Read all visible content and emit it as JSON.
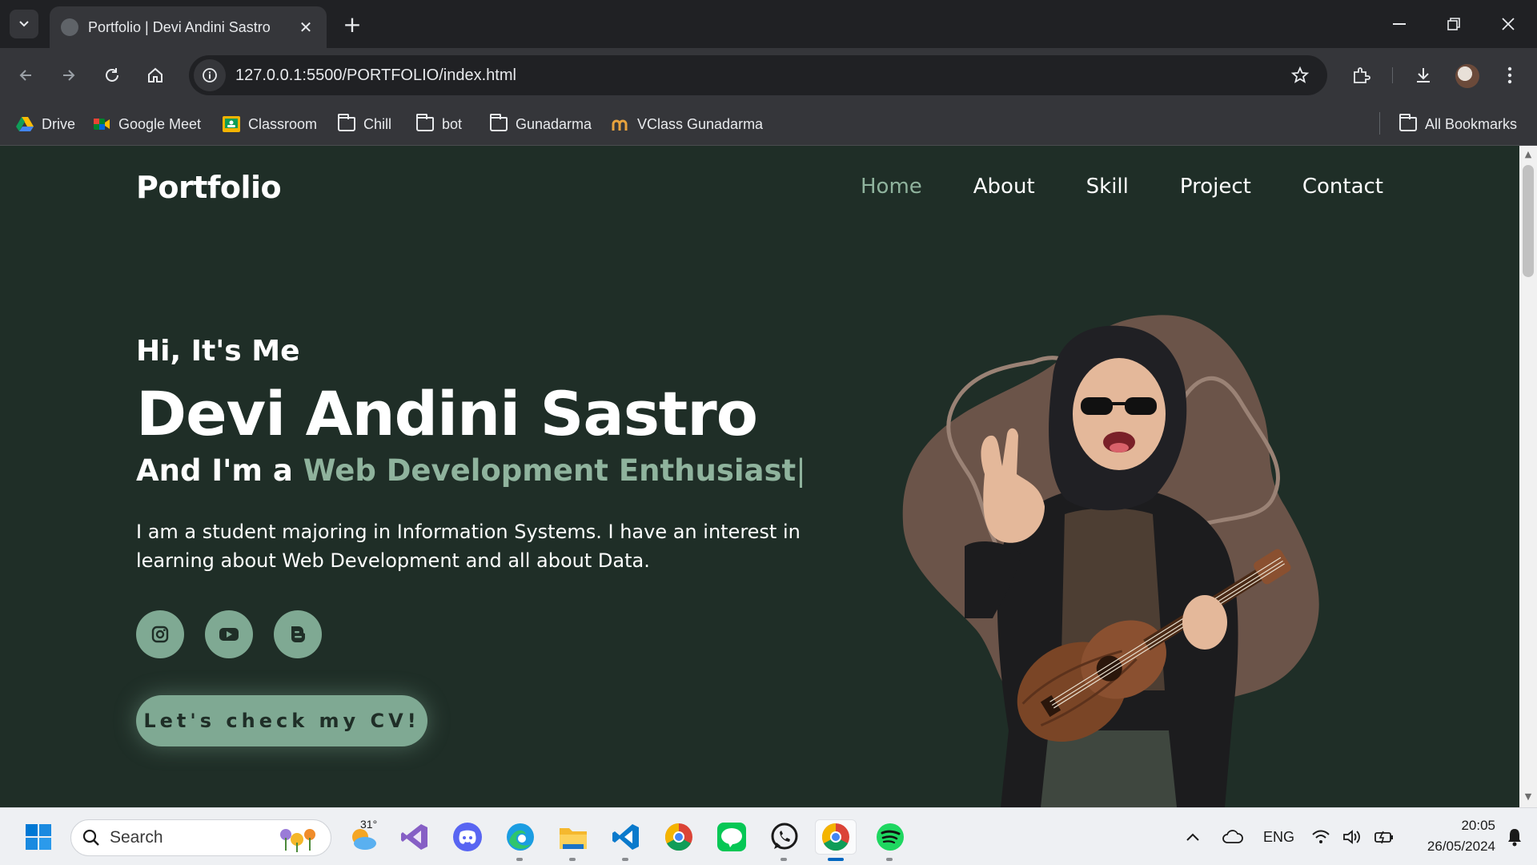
{
  "browser": {
    "tab_title": "Portfolio | Devi Andini Sastro",
    "url": "127.0.0.1:5500/PORTFOLIO/index.html",
    "bookmarks": [
      {
        "label": "Drive",
        "icon": "google-drive-icon"
      },
      {
        "label": "Google Meet",
        "icon": "google-meet-icon"
      },
      {
        "label": "Classroom",
        "icon": "google-classroom-icon"
      },
      {
        "label": "Chill",
        "icon": "folder-icon"
      },
      {
        "label": "bot",
        "icon": "folder-icon"
      },
      {
        "label": "Gunadarma",
        "icon": "folder-icon"
      },
      {
        "label": "VClass Gunadarma",
        "icon": "vclass-icon"
      }
    ],
    "all_bookmarks": "All Bookmarks"
  },
  "site": {
    "logo": "Portfolio",
    "nav": [
      "Home",
      "About",
      "Skill",
      "Project",
      "Contact"
    ],
    "active_nav": "Home",
    "greeting": "Hi, It's Me",
    "name": "Devi Andini Sastro",
    "role_prefix": "And I'm a ",
    "role_highlight": "Web Development Enthusiast",
    "role_caret": "|",
    "description": "I am a student majoring in Information Systems. I have an interest in learning about Web Development and all about Data.",
    "socials": [
      "instagram-icon",
      "youtube-icon",
      "blogger-icon"
    ],
    "cv_button": "Let's check my CV!",
    "colors": {
      "background": "#1f2e27",
      "accent": "#8fb39d",
      "button": "#7fa993",
      "blob": "#6b5449"
    }
  },
  "taskbar": {
    "search_placeholder": "Search",
    "weather_temp": "31°",
    "language": "ENG",
    "time": "20:05",
    "date": "26/05/2024"
  }
}
